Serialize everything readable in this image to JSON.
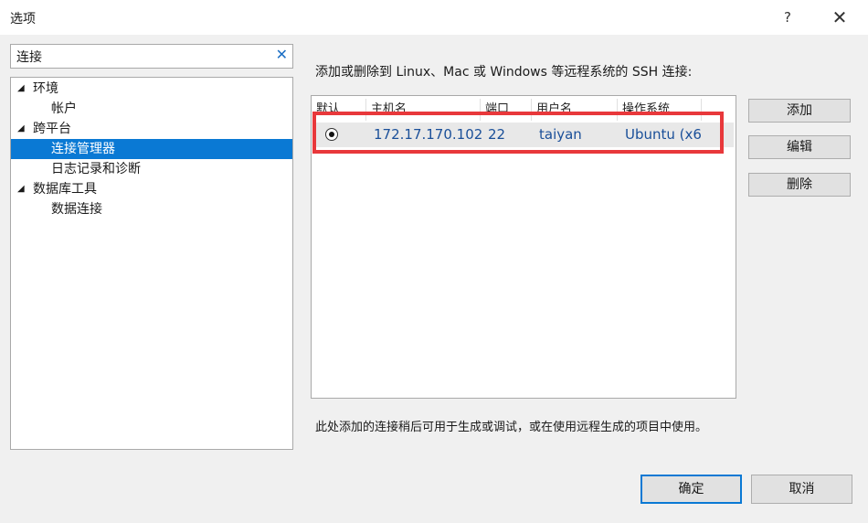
{
  "window": {
    "title": "选项",
    "help_label": "?",
    "close_label": "✕"
  },
  "search": {
    "value": "连接",
    "clear_label": "✕"
  },
  "tree": {
    "env": {
      "label": "环境",
      "child_account": "帐户"
    },
    "cross": {
      "label": "跨平台",
      "child_connmgr": "连接管理器",
      "child_logging": "日志记录和诊断"
    },
    "db": {
      "label": "数据库工具",
      "child_dataconn": "数据连接"
    },
    "expand_glyph": "◢"
  },
  "main": {
    "description": "添加或删除到 Linux、Mac 或 Windows 等远程系统的 SSH 连接:",
    "columns": [
      "默认",
      "主机名",
      "端口",
      "用户名",
      "操作系统"
    ],
    "rows": [
      {
        "host": "172.17.170.102",
        "port": "22",
        "user": "taiyan",
        "os": "Ubuntu (x6"
      }
    ],
    "note": "此处添加的连接稍后可用于生成或调试，或在使用远程生成的项目中使用。"
  },
  "buttons": {
    "add": "添加",
    "edit": "编辑",
    "remove": "删除",
    "ok": "确定",
    "cancel": "取消"
  },
  "colors": {
    "highlight": "#e8383b",
    "selection": "#0a79d4"
  }
}
